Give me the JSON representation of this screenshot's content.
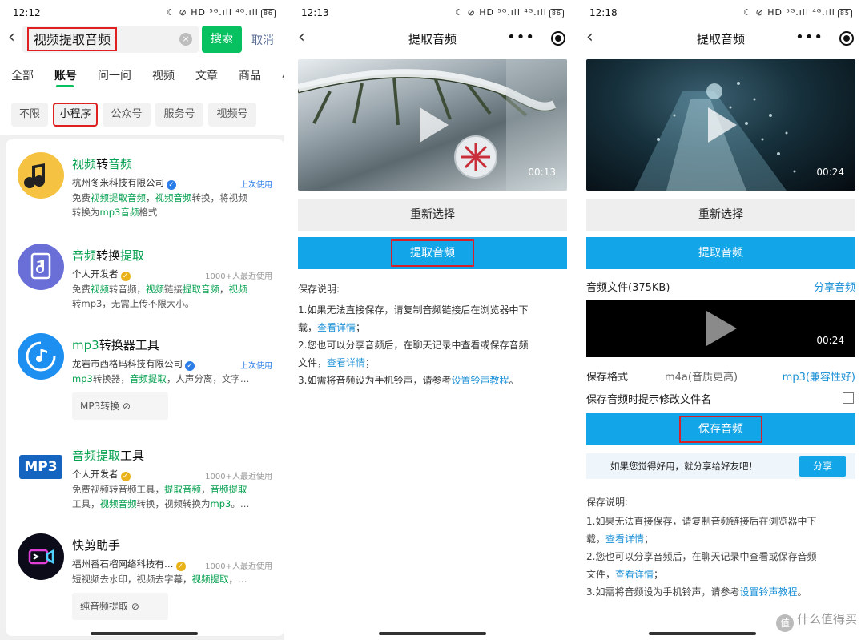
{
  "panel1": {
    "status": {
      "time": "12:12",
      "icons": "☾ ⊘ HD ⁵ᴳ.ıll ⁴ᴳ.ıll",
      "battery": "86"
    },
    "search": {
      "query": "视频提取音频",
      "search_label": "搜索",
      "cancel_label": "取消"
    },
    "tabs": [
      "全部",
      "账号",
      "问一问",
      "视频",
      "文章",
      "商品",
      "小"
    ],
    "chips": [
      "不限",
      "小程序",
      "公众号",
      "服务号",
      "视频号"
    ],
    "results": [
      {
        "title_hl1": "视频",
        "title_mid": "转",
        "title_hl2": "音频",
        "title_tail": "",
        "developer": "杭州冬米科技有限公司",
        "badge": "✓",
        "meta": "上次使用",
        "desc_line1_a": "免费",
        "desc_line1_hl1": "视频提取音频",
        "desc_line1_b": "，",
        "desc_line1_hl2": "视频音频",
        "desc_line1_c": "转换，将视频",
        "desc_line2_a": "转换为",
        "desc_line2_hl": "mp3音频",
        "desc_line2_b": "格式",
        "icon": "music-note-icon",
        "color": "#f5c242"
      },
      {
        "title_hl1": "音频",
        "title_mid": "转换",
        "title_hl2": "提取",
        "title_tail": "",
        "developer": "个人开发者",
        "badge": "✓",
        "meta": "1000+人最近使用",
        "desc_line1_a": "免费",
        "desc_line1_hl1": "视频",
        "desc_line1_b": "转音频，",
        "desc_line1_hl2": "视频",
        "desc_line1_c": "链接",
        "desc_line1_hl3": "提取音频",
        "desc_line1_d": "，",
        "desc_line1_hl4": "视频",
        "desc_line2_a": "转mp3，无需上传不限大小。",
        "icon": "music-file-icon",
        "color": "#6a6fd8"
      },
      {
        "title_hl1": "mp3",
        "title_mid": "转换器工具",
        "title_hl2": "",
        "title_tail": "",
        "developer": "龙岩市西格玛科技有限公司",
        "badge": "✓",
        "meta": "上次使用",
        "desc_line1_hl1": "mp3",
        "desc_line1_a": "转换器，",
        "desc_line1_hl2": "音频提取",
        "desc_line1_b": "，人声分离，文字…",
        "sub_button": "MP3转换 ⊘",
        "icon": "audio-sync-icon",
        "color": "#1d8ff0"
      },
      {
        "title_hl1": "音频提取",
        "title_mid": "工具",
        "title_hl2": "",
        "title_tail": "",
        "developer": "个人开发者",
        "badge": "✓",
        "meta": "1000+人最近使用",
        "desc_line1_a": "免费视频转音频工具，",
        "desc_line1_hl1": "提取音频",
        "desc_line1_b": "，",
        "desc_line1_hl2": "音频提取",
        "desc_line2_a": "工具，",
        "desc_line2_hl": "视频音频",
        "desc_line2_b": "转换，视频转换为",
        "desc_line2_hl2": "mp3",
        "desc_line2_c": "。…",
        "icon_text": "MP3",
        "icon": "mp3-logo-icon",
        "color": "#1565c0"
      },
      {
        "title_hl1": "",
        "title_mid": "快剪助手",
        "title_hl2": "",
        "title_tail": "",
        "developer": "福州番石榴网络科技有…",
        "badge": "✓",
        "meta": "1000+人最近使用",
        "desc_line1_a": "短视频去水印，视频去字幕，",
        "desc_line1_hl1": "视频提取",
        "desc_line1_b": "，…",
        "sub_button": "纯音频提取 ⊘",
        "icon": "video-camera-icon",
        "color": "#0b0b1a"
      }
    ]
  },
  "panel2": {
    "status": {
      "time": "12:13",
      "icons": "☾ ⊘ HD ⁵ᴳ.ıll ⁴ᴳ.ıll",
      "battery": "86"
    },
    "title": "提取音频",
    "video_time": "00:13",
    "reselect": "重新选择",
    "extract": "提取音频",
    "notes_title": "保存说明:",
    "note1_a": "1.如果无法直接保存，请复制音频链接后在浏览器中下",
    "note1_b": "载，",
    "note1_link": "查看详情",
    "note1_c": "；",
    "note2_a": "2.您也可以分享音频后，在聊天记录中查看或保存音频",
    "note2_b": "文件，",
    "note2_link": "查看详情",
    "note2_c": "；",
    "note3_a": "3.如需将音频设为手机铃声，请参考",
    "note3_link": "设置铃声教程",
    "note3_c": "。"
  },
  "panel3": {
    "status": {
      "time": "12:18",
      "icons": "☾ ⊘ HD ⁵ᴳ.ıll ⁴ᴳ.ıll",
      "battery": "85"
    },
    "title": "提取音频",
    "video_time": "00:24",
    "reselect": "重新选择",
    "extract": "提取音频",
    "audio_file": "音频文件(375KB)",
    "share_audio": "分享音频",
    "audio_time": "00:24",
    "format_label": "保存格式",
    "format_m4a": "m4a(音质更高)",
    "format_mp3": "mp3(兼容性好)",
    "rename_label": "保存音频时提示修改文件名",
    "save": "保存音频",
    "share_text": "如果您觉得好用，就分享给好友吧！",
    "share_btn": "分享",
    "notes_title": "保存说明:",
    "note1_a": "1.如果无法直接保存，请复制音频链接后在浏览器中下",
    "note1_b": "载，",
    "note1_link": "查看详情",
    "note1_c": "；",
    "note2_a": "2.您也可以分享音频后，在聊天记录中查看或保存音频",
    "note2_b": "文件，",
    "note2_link": "查看详情",
    "note2_c": "；",
    "note3_a": "3.如需将音频设为手机铃声，请参考",
    "note3_link": "设置铃声教程",
    "note3_c": "。",
    "watermark_icon": "值",
    "watermark": "什么值得买"
  }
}
